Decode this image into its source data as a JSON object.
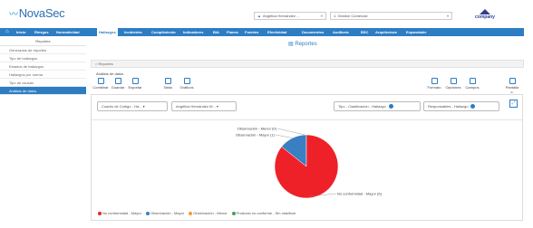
{
  "brand": {
    "logo_text": "NovaSec"
  },
  "header": {
    "user_select": "Angélica Hernández ...",
    "company_select": "1. Gestión Comercial",
    "company_logo_text": "company"
  },
  "navbar": {
    "items": [
      {
        "label": "Inicio",
        "active": false
      },
      {
        "label": "Riesgos",
        "active": false
      },
      {
        "label": "Normatividad",
        "active": false
      },
      {
        "label": "Hallazgos",
        "active": true
      },
      {
        "label": "Incidentes",
        "active": false
      },
      {
        "label": "Cumplimiento",
        "active": false
      },
      {
        "label": "Indicadores",
        "active": false
      },
      {
        "label": "BIA",
        "active": false
      },
      {
        "label": "Planes",
        "active": false
      },
      {
        "label": "Fuentes",
        "active": false
      },
      {
        "label": "Efectividad",
        "active": false
      },
      {
        "label": "Documentos",
        "active": false
      },
      {
        "label": "Auditoría",
        "active": false
      },
      {
        "label": "BSC",
        "active": false
      },
      {
        "label": "Arquitectura",
        "active": false
      },
      {
        "label": "Expandable",
        "active": false
      }
    ]
  },
  "sidebar": {
    "heading": "Reportes",
    "items": [
      {
        "label": "Generados de reportes",
        "active": false
      },
      {
        "label": "Tipo de hallazgos",
        "active": false
      },
      {
        "label": "Estados de hallazgos",
        "active": false
      },
      {
        "label": "Hallazgos por norma",
        "active": false
      },
      {
        "label": "Tipo de causas",
        "active": false
      },
      {
        "label": "Análisis de datos",
        "active": true
      }
    ]
  },
  "main": {
    "title": "Reportes",
    "breadcrumb": "Reportes",
    "section": "Análisis de datos",
    "toolbar_left": [
      {
        "label": "Combinar",
        "icon": "combine-icon"
      },
      {
        "label": "Guardar",
        "icon": "save-icon"
      },
      {
        "label": "Exportar",
        "icon": "export-icon"
      },
      {
        "label": "Tabla",
        "icon": "table-icon"
      },
      {
        "label": "Gráficos",
        "icon": "chart-icon"
      }
    ],
    "toolbar_right": [
      {
        "label": "Formato",
        "icon": "format-icon"
      },
      {
        "label": "Opciones",
        "icon": "options-icon"
      },
      {
        "label": "Campos",
        "icon": "fields-icon"
      },
      {
        "label": "Pantalla c.",
        "icon": "fullscreen-icon"
      }
    ],
    "filters": {
      "left": [
        "Cuadro de Código - Ha...",
        "Angélica Hernández M..."
      ],
      "right": [
        "Tipo - Clasificación - Hallazgo",
        "Responsables - Hallazgo"
      ]
    }
  },
  "chart_data": {
    "type": "pie",
    "slices": [
      {
        "name": "No conformidad - Mayor",
        "label": "No conformidad - Mayor (6)",
        "value": 6,
        "color": "#ee2129"
      },
      {
        "name": "Observación - Mayor",
        "label": "Observación - Mayor (1)",
        "value": 1,
        "color": "#3a7fc1"
      },
      {
        "name": "Observación - Menor",
        "label": "Observación - Menor (0)",
        "value": 0,
        "color": "#f49b34"
      },
      {
        "name": "Producto no conforme - Sin clasificar",
        "label": "",
        "value": 0,
        "color": "#3aa655"
      }
    ],
    "legend": [
      {
        "label": "No conformidad - Mayor",
        "color": "#ee2129"
      },
      {
        "label": "Observación - Mayor",
        "color": "#3a7fc1"
      },
      {
        "label": "Observación - Menor",
        "color": "#f49b34"
      },
      {
        "label": "Producto no conforme - Sin clasificar",
        "color": "#3aa655"
      }
    ],
    "legend_position": "bottom-left"
  },
  "colors": {
    "nav_bg": "#2d7dc3",
    "accent": "#2d7dc3"
  }
}
